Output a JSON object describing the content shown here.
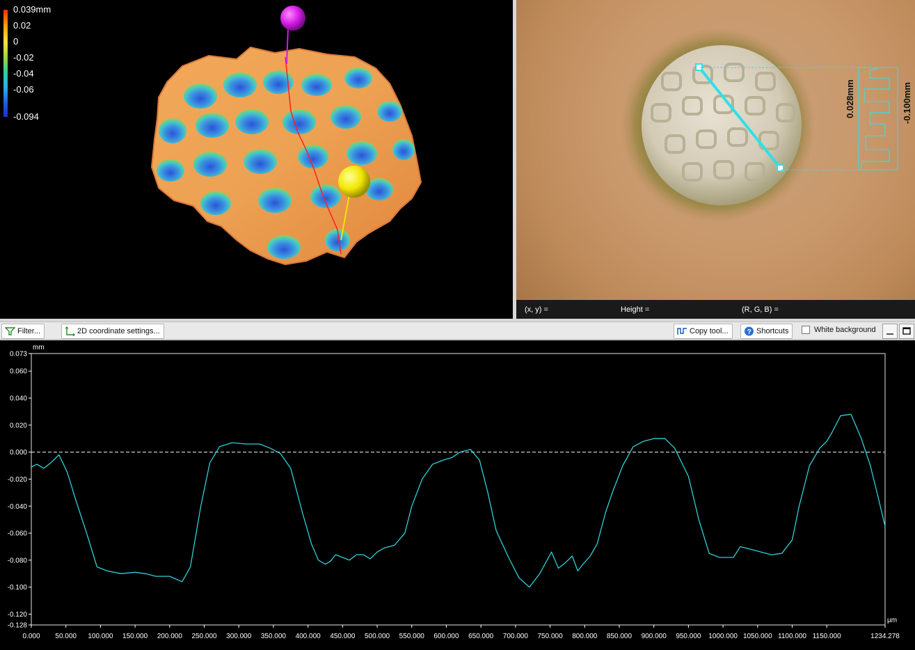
{
  "colorbar": {
    "max_label": "0.039mm",
    "labels": [
      "0.02",
      "0",
      "-0.02",
      "-0.04",
      "-0.06"
    ],
    "min_label": "-0.094"
  },
  "image_view": {
    "height_annotation": "0.028mm",
    "depth_annotation": "-0.100mm"
  },
  "status_bar": {
    "xy": "(x, y)   =",
    "height": "Height   =",
    "rgb": "(R, G, B)   ="
  },
  "toolbar": {
    "filter_label": "Filter...",
    "coord_label": "2D coordinate settings...",
    "copy_label": "Copy tool...",
    "shortcuts_label": "Shortcuts",
    "white_bg_label": "White background",
    "white_bg_checked": false
  },
  "colors": {
    "profile_line": "#2fd0d8",
    "zero_line": "#c8c8c8",
    "marker_top": "#d41ae6",
    "marker_bottom": "#f2e600"
  },
  "chart_data": {
    "type": "line",
    "ylabel": "mm",
    "xlabel": "µm",
    "xlim": [
      0,
      1234.278
    ],
    "ylim": [
      -0.128,
      0.073
    ],
    "y_tick_labels": [
      "0.073",
      "0.060",
      "0.040",
      "0.020",
      "0.000",
      "-0.020",
      "-0.040",
      "-0.060",
      "-0.080",
      "-0.100",
      "-0.120",
      "-0.128"
    ],
    "y_ticks": [
      0.073,
      0.06,
      0.04,
      0.02,
      0,
      -0.02,
      -0.04,
      -0.06,
      -0.08,
      -0.1,
      -0.12,
      -0.128
    ],
    "x_tick_labels": [
      "0.000",
      "50.000",
      "100.000",
      "150.000",
      "200.000",
      "250.000",
      "300.000",
      "350.000",
      "400.000",
      "450.000",
      "500.000",
      "550.000",
      "600.000",
      "650.000",
      "700.000",
      "750.000",
      "800.000",
      "850.000",
      "900.000",
      "950.000",
      "1000.000",
      "1050.000",
      "1100.000",
      "1150.000",
      "1234.278"
    ],
    "x_ticks": [
      0,
      50,
      100,
      150,
      200,
      250,
      300,
      350,
      400,
      450,
      500,
      550,
      600,
      650,
      700,
      750,
      800,
      850,
      900,
      950,
      1000,
      1050,
      1100,
      1150,
      1234.278
    ],
    "zero_line": 0,
    "series": [
      {
        "x": [
          0,
          8,
          18,
          28,
          40,
          52,
          64,
          80,
          95,
          110,
          130,
          150,
          165,
          180,
          200,
          218,
          230,
          245,
          258,
          272,
          290,
          310,
          330,
          345,
          360,
          375,
          392,
          405,
          415,
          425,
          432,
          440,
          450,
          460,
          470,
          480,
          490,
          500,
          510,
          525,
          540,
          550,
          565,
          580,
          595,
          608,
          620,
          635,
          648,
          660,
          672,
          690,
          705,
          720,
          735,
          752,
          762,
          772,
          782,
          790,
          796,
          808,
          818,
          830,
          840,
          855,
          870,
          885,
          900,
          916,
          930,
          950,
          965,
          980,
          995,
          1005,
          1015,
          1025,
          1040,
          1055,
          1070,
          1085,
          1100,
          1110,
          1125,
          1140,
          1150,
          1158,
          1170,
          1185,
          1200,
          1213,
          1225,
          1234.278
        ],
        "y": [
          -0.011,
          -0.009,
          -0.012,
          -0.008,
          -0.002,
          -0.015,
          -0.035,
          -0.06,
          -0.085,
          -0.088,
          -0.09,
          -0.089,
          -0.09,
          -0.092,
          -0.092,
          -0.096,
          -0.085,
          -0.04,
          -0.008,
          0.004,
          0.007,
          0.006,
          0.006,
          0.003,
          -0.001,
          -0.012,
          -0.045,
          -0.068,
          -0.08,
          -0.083,
          -0.081,
          -0.076,
          -0.078,
          -0.08,
          -0.076,
          -0.076,
          -0.079,
          -0.074,
          -0.071,
          -0.069,
          -0.06,
          -0.04,
          -0.02,
          -0.009,
          -0.006,
          -0.004,
          0.0,
          0.002,
          -0.006,
          -0.03,
          -0.058,
          -0.078,
          -0.093,
          -0.1,
          -0.09,
          -0.074,
          -0.086,
          -0.082,
          -0.077,
          -0.088,
          -0.084,
          -0.077,
          -0.068,
          -0.045,
          -0.03,
          -0.01,
          0.004,
          0.008,
          0.01,
          0.01,
          0.003,
          -0.018,
          -0.05,
          -0.075,
          -0.078,
          -0.078,
          -0.078,
          -0.07,
          -0.072,
          -0.074,
          -0.076,
          -0.075,
          -0.065,
          -0.04,
          -0.01,
          0.003,
          0.008,
          0.015,
          0.027,
          0.028,
          0.01,
          -0.01,
          -0.035,
          -0.055
        ]
      }
    ]
  }
}
